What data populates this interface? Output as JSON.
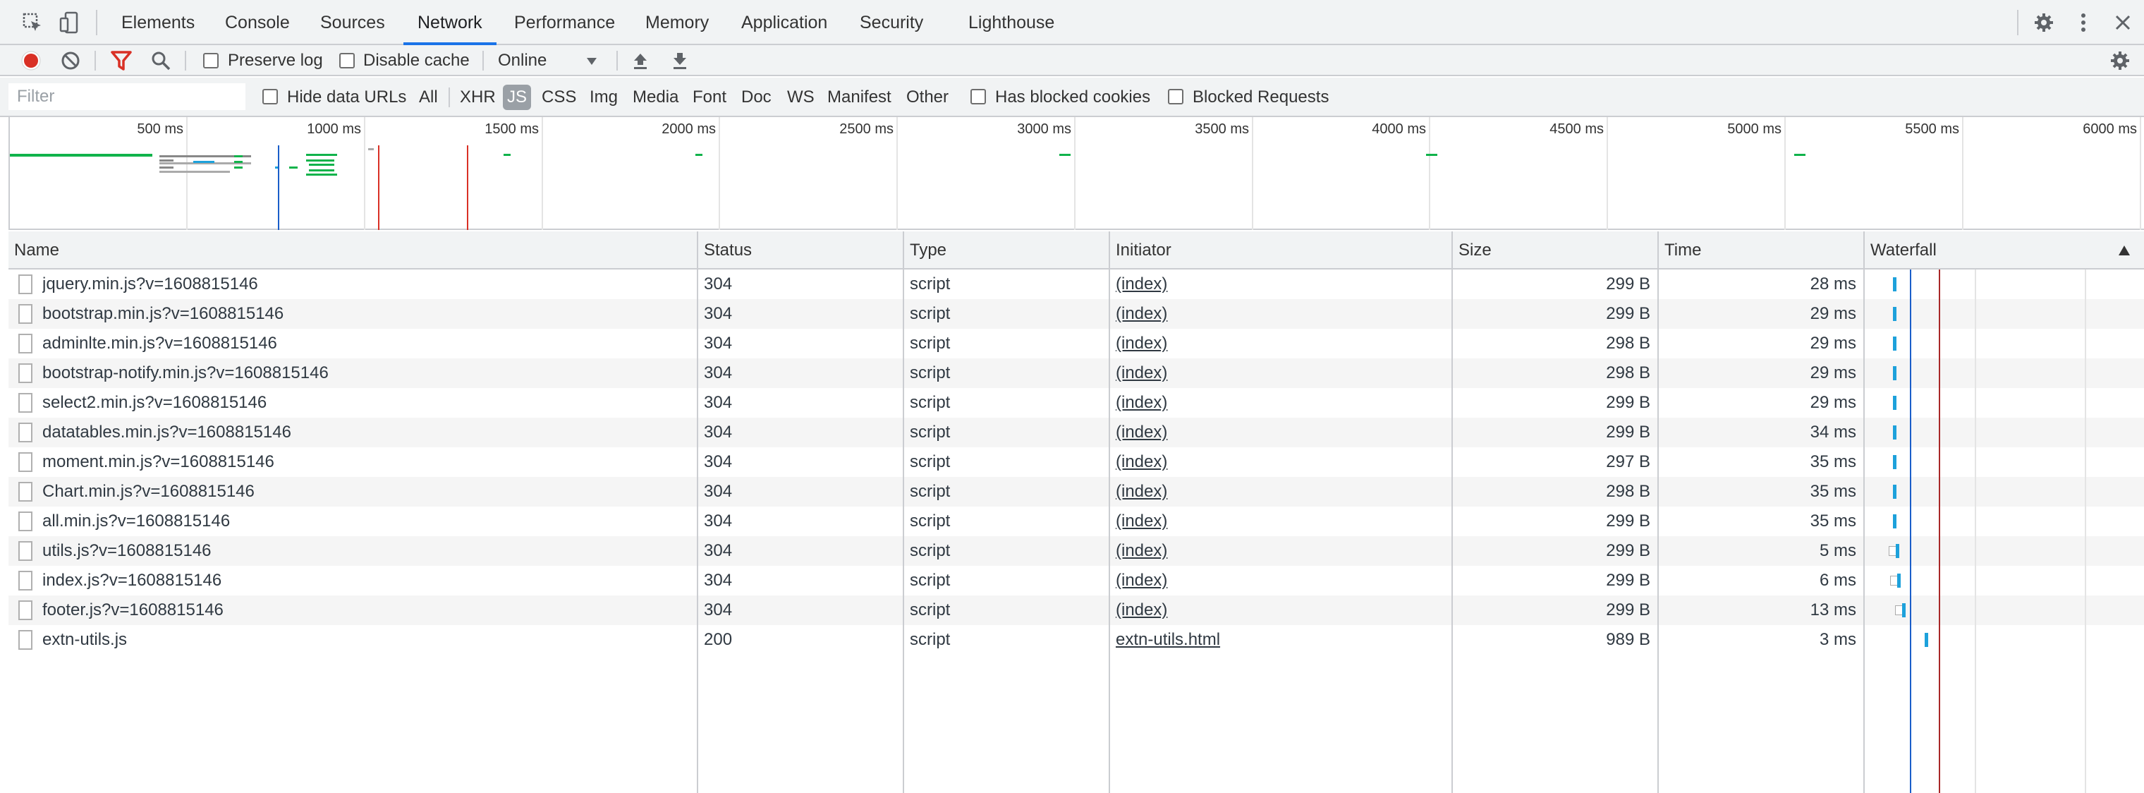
{
  "tabs": [
    "Elements",
    "Console",
    "Sources",
    "Network",
    "Performance",
    "Memory",
    "Application",
    "Security",
    "Lighthouse"
  ],
  "active_tab": "Network",
  "toolbar": {
    "preserve_log": "Preserve log",
    "disable_cache": "Disable cache",
    "throttle": "Online"
  },
  "filterbar": {
    "placeholder": "Filter",
    "hide_data_urls": "Hide data URLs",
    "types": [
      "All",
      "XHR",
      "JS",
      "CSS",
      "Img",
      "Media",
      "Font",
      "Doc",
      "WS",
      "Manifest",
      "Other"
    ],
    "active_type": "JS",
    "has_blocked_cookies": "Has blocked cookies",
    "blocked_requests": "Blocked Requests"
  },
  "overview": {
    "ticks": [
      "500 ms",
      "1000 ms",
      "1500 ms",
      "2000 ms",
      "2500 ms",
      "3000 ms",
      "3500 ms",
      "4000 ms",
      "4500 ms",
      "5000 ms",
      "5500 ms",
      "6000 ms"
    ]
  },
  "columns": {
    "name": "Name",
    "status": "Status",
    "type": "Type",
    "initiator": "Initiator",
    "size": "Size",
    "time": "Time",
    "waterfall": "Waterfall"
  },
  "rows": [
    {
      "name": "jquery.min.js?v=1608815146",
      "status": "304",
      "type": "script",
      "initiator": "(index)",
      "size": "299 B",
      "time": "28 ms"
    },
    {
      "name": "bootstrap.min.js?v=1608815146",
      "status": "304",
      "type": "script",
      "initiator": "(index)",
      "size": "299 B",
      "time": "29 ms"
    },
    {
      "name": "adminlte.min.js?v=1608815146",
      "status": "304",
      "type": "script",
      "initiator": "(index)",
      "size": "298 B",
      "time": "29 ms"
    },
    {
      "name": "bootstrap-notify.min.js?v=1608815146",
      "status": "304",
      "type": "script",
      "initiator": "(index)",
      "size": "298 B",
      "time": "29 ms"
    },
    {
      "name": "select2.min.js?v=1608815146",
      "status": "304",
      "type": "script",
      "initiator": "(index)",
      "size": "299 B",
      "time": "29 ms"
    },
    {
      "name": "datatables.min.js?v=1608815146",
      "status": "304",
      "type": "script",
      "initiator": "(index)",
      "size": "299 B",
      "time": "34 ms"
    },
    {
      "name": "moment.min.js?v=1608815146",
      "status": "304",
      "type": "script",
      "initiator": "(index)",
      "size": "297 B",
      "time": "35 ms"
    },
    {
      "name": "Chart.min.js?v=1608815146",
      "status": "304",
      "type": "script",
      "initiator": "(index)",
      "size": "298 B",
      "time": "35 ms"
    },
    {
      "name": "all.min.js?v=1608815146",
      "status": "304",
      "type": "script",
      "initiator": "(index)",
      "size": "299 B",
      "time": "35 ms"
    },
    {
      "name": "utils.js?v=1608815146",
      "status": "304",
      "type": "script",
      "initiator": "(index)",
      "size": "299 B",
      "time": "5 ms"
    },
    {
      "name": "index.js?v=1608815146",
      "status": "304",
      "type": "script",
      "initiator": "(index)",
      "size": "299 B",
      "time": "6 ms"
    },
    {
      "name": "footer.js?v=1608815146",
      "status": "304",
      "type": "script",
      "initiator": "(index)",
      "size": "299 B",
      "time": "13 ms"
    },
    {
      "name": "extn-utils.js",
      "status": "200",
      "type": "script",
      "initiator": "extn-utils.html",
      "size": "989 B",
      "time": "3 ms"
    }
  ],
  "colors": {
    "record": "#d93025",
    "filter_active": "#d93025",
    "accent": "#1a73e8",
    "waterfall_bar": "#1da1db",
    "dom_content_loaded": "#1a5ec9",
    "load": "#a82828",
    "overview_green": "#10b34b"
  }
}
